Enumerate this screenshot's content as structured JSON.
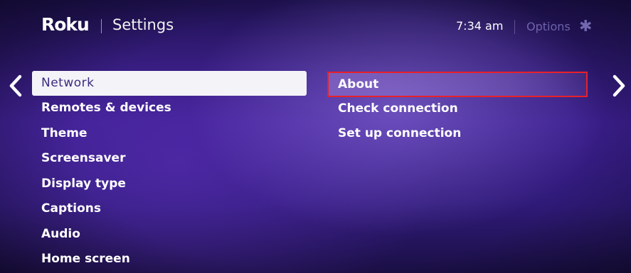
{
  "header": {
    "brand": "Roku",
    "title": "Settings",
    "time": "7:34 am",
    "options_label": "Options",
    "options_icon": "✱"
  },
  "navigation": {
    "left_icon": "chevron-left-icon",
    "right_icon": "chevron-right-icon"
  },
  "menu": {
    "items": [
      {
        "label": "Network",
        "selected": true
      },
      {
        "label": "Remotes & devices"
      },
      {
        "label": "Theme"
      },
      {
        "label": "Screensaver"
      },
      {
        "label": "Display type"
      },
      {
        "label": "Captions"
      },
      {
        "label": "Audio"
      },
      {
        "label": "Home screen"
      }
    ]
  },
  "submenu": {
    "items": [
      {
        "label": "About",
        "focused": true
      },
      {
        "label": "Check connection"
      },
      {
        "label": "Set up connection"
      }
    ]
  },
  "colors": {
    "background": "#2f1a78",
    "selected_bg": "#f4f3f8",
    "selected_text": "#3b2c7e",
    "focus_outline": "#e8202a",
    "options_dim": "#877dc8"
  }
}
